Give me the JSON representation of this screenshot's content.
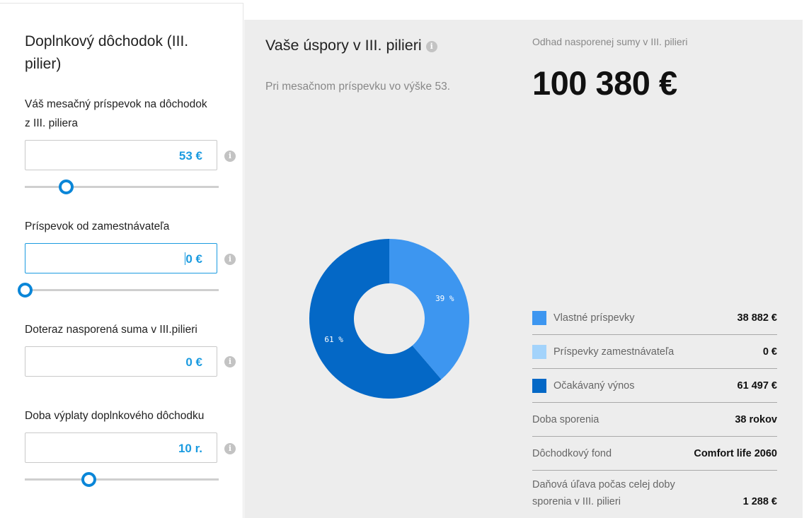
{
  "left": {
    "title": "Doplnkový dôchodok (III. pilier)",
    "monthly": {
      "label": "Váš mesačný príspevok na dôchodok z III. piliera",
      "value": "53 €",
      "slider_fraction": 0.21
    },
    "employer": {
      "label": "Príspevok od zamestnávateľa",
      "value": "0 €",
      "slider_fraction": 0.0
    },
    "saved": {
      "label": "Doteraz nasporená suma v III.pilieri",
      "value": "0 €"
    },
    "payout": {
      "label": "Doba výplaty doplnkového dôchodku",
      "value": "10 r.",
      "slider_fraction": 0.33
    },
    "info_icon": "i"
  },
  "main": {
    "title": "Vaše úspory v III. pilieri",
    "subtitle": "Pri mesačnom príspevku vo výške 53.",
    "estimate_label": "Odhad nasporenej sumy v III. pilieri",
    "estimate_value": "100 380 €"
  },
  "chart_data": {
    "type": "pie",
    "categories": [
      "Vlastné príspevky",
      "Príspevky zamestnávateľa",
      "Očakávaný výnos"
    ],
    "values": [
      38882,
      0,
      61497
    ],
    "slice_labels": [
      "39 %",
      "0 %",
      "61 %"
    ],
    "colors": [
      "#3d96f0",
      "#a3d3fb",
      "#0468c6"
    ]
  },
  "legend": [
    {
      "label": "Vlastné príspevky",
      "value": "38 882 €",
      "color": "#3d96f0"
    },
    {
      "label": "Príspevky zamestnávateľa",
      "value": "0 €",
      "color": "#a3d3fb"
    },
    {
      "label": "Očakávaný výnos",
      "value": "61 497 €",
      "color": "#0468c6"
    }
  ],
  "details": [
    {
      "label": "Doba sporenia",
      "value": "38 rokov"
    },
    {
      "label": "Dôchodkový fond",
      "value": "Comfort life 2060"
    }
  ],
  "tax": {
    "label": "Daňová úľava počas celej doby sporenia v III. pilieri",
    "value": "1 288 €"
  }
}
